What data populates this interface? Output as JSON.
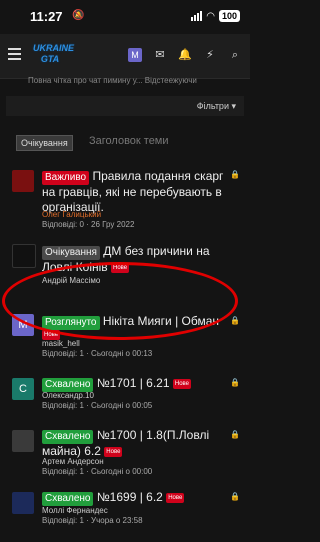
{
  "status_bar": {
    "time": "11:27",
    "battery": "100"
  },
  "nav": {
    "logo_line1": "UKRAINE",
    "logo_line2": "GTA",
    "avatar_letter": "M"
  },
  "trail": "Повна чітка про чат пимину у... Відстеежуючи",
  "filters": {
    "label": "Фільтри ▾"
  },
  "new_thread": {
    "prefix": "Очікування",
    "placeholder": "Заголовок теми"
  },
  "threads": [
    {
      "prefix": "Важливо",
      "title": "Правила подання скарг на гравців, які не перебувають в організації.",
      "author": "Олег Галицький",
      "meta": "Відповіді: 0 · 26 Гру 2022"
    },
    {
      "prefix": "Очікування",
      "title": "ДМ без причини на Ловлі Коінів",
      "new": "Нове",
      "author": "Андрій Массімо"
    },
    {
      "avatar": "M",
      "prefix": "Розглянуто",
      "title": "Нікіта Мияги | Обман",
      "new": "Нове",
      "author": "masik_hell",
      "meta": "Відповіді: 1 · Сьогодні о 00:13"
    },
    {
      "avatar": "C",
      "prefix": "Схвалено",
      "title": "№1701 | 6.21",
      "new": "Нове",
      "author": "Олександр.10",
      "meta": "Відповіді: 1 · Сьогодні о 00:05"
    },
    {
      "prefix": "Схвалено",
      "title": "№1700 | 1.8(П.Ловлі майна) 6.2",
      "new": "Нове",
      "author": "Артем Андерсон",
      "meta": "Відповіді: 1 · Сьогодні о 00:00"
    },
    {
      "prefix": "Схвалено",
      "title": "№1699 | 6.2",
      "new": "Нове",
      "author": "Моллі Фернандес",
      "meta": "Відповіді: 1 · Учора о 23:58"
    }
  ]
}
